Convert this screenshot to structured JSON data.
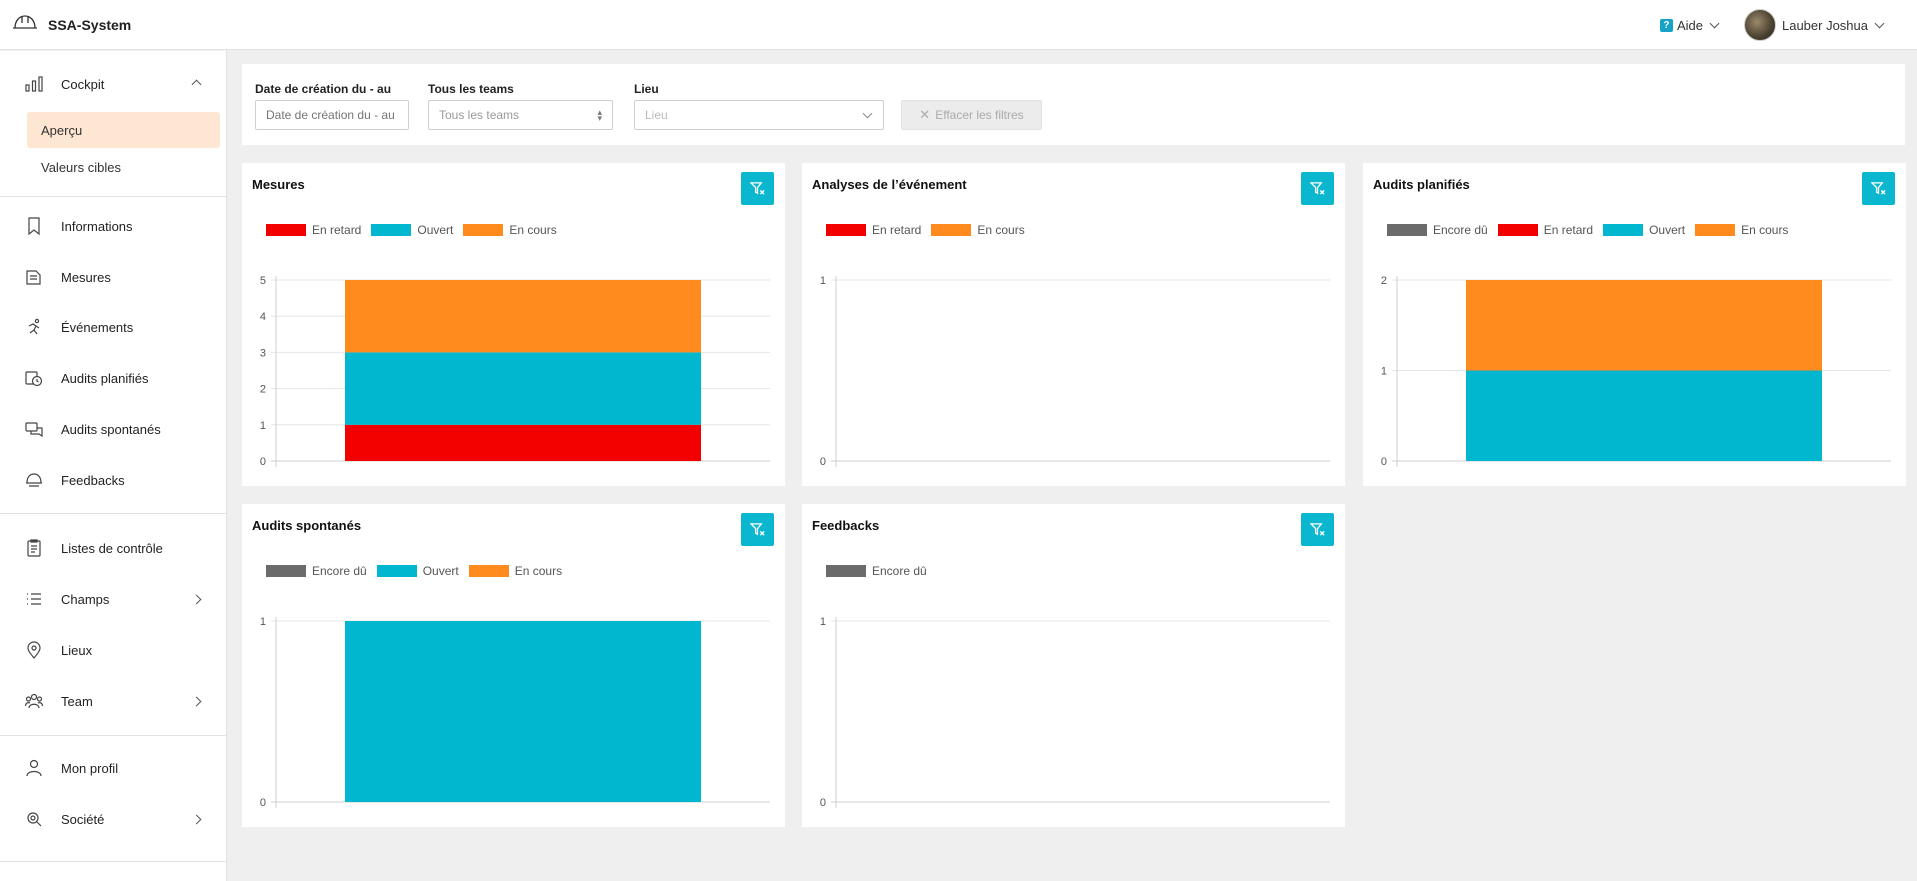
{
  "app": {
    "name": "SSA-System",
    "logo_icon": "hard-hat-icon"
  },
  "header": {
    "help_label": "Aide",
    "user_name": "Lauber Joshua"
  },
  "colors": {
    "accent": "#0bb7cf",
    "late": "#f20000",
    "open": "#00b7cf",
    "in_progress": "#ff8a1d",
    "due": "#6b6b6b",
    "active_bg": "#fde7d2"
  },
  "sidebar": {
    "cockpit": {
      "label": "Cockpit",
      "icon": "bar-chart-icon"
    },
    "cockpit_sub": [
      {
        "label": "Aperçu"
      },
      {
        "label": "Valeurs cibles"
      }
    ],
    "items": [
      {
        "label": "Informations",
        "icon": "bookmark-icon"
      },
      {
        "label": "Mesures",
        "icon": "document-icon"
      },
      {
        "label": "Événements",
        "icon": "running-person-icon"
      },
      {
        "label": "Audits planifiés",
        "icon": "calendar-clock-icon"
      },
      {
        "label": "Audits spontanés",
        "icon": "chat-icon"
      },
      {
        "label": "Feedbacks",
        "icon": "helmet-icon"
      }
    ],
    "items2": [
      {
        "label": "Listes de contrôle",
        "icon": "checklist-icon"
      },
      {
        "label": "Champs",
        "icon": "list-icon"
      },
      {
        "label": "Lieux",
        "icon": "location-pin-icon"
      },
      {
        "label": "Team",
        "icon": "team-icon"
      }
    ],
    "items3": [
      {
        "label": "Mon profil",
        "icon": "user-icon"
      },
      {
        "label": "Société",
        "icon": "company-settings-icon"
      }
    ]
  },
  "filters": {
    "date_label": "Date de création du - au",
    "date_placeholder": "Date de création du - au",
    "teams_label": "Tous les teams",
    "teams_value": "Tous les teams",
    "place_label": "Lieu",
    "place_placeholder": "Lieu",
    "clear_label": "Effacer les filtres"
  },
  "chart_data": [
    {
      "type": "bar",
      "title": "Mesures",
      "categories": [
        ""
      ],
      "series": [
        {
          "name": "En retard",
          "values": [
            1
          ]
        },
        {
          "name": "Ouvert",
          "values": [
            2
          ]
        },
        {
          "name": "En cours",
          "values": [
            2
          ]
        }
      ],
      "stacked": true,
      "ylim": [
        0,
        5
      ],
      "yticks": [
        0,
        1,
        2,
        3,
        4,
        5
      ],
      "grid": true,
      "legend": "top-left"
    },
    {
      "type": "bar",
      "title": "Analyses de l’événement",
      "categories": [
        ""
      ],
      "series": [
        {
          "name": "En retard",
          "values": [
            0
          ]
        },
        {
          "name": "En cours",
          "values": [
            0
          ]
        }
      ],
      "stacked": true,
      "ylim": [
        0,
        1
      ],
      "yticks": [
        0,
        1
      ],
      "grid": true,
      "legend": "top-left"
    },
    {
      "type": "bar",
      "title": "Audits planifiés",
      "categories": [
        ""
      ],
      "series": [
        {
          "name": "Encore dû",
          "values": [
            0
          ]
        },
        {
          "name": "En retard",
          "values": [
            0
          ]
        },
        {
          "name": "Ouvert",
          "values": [
            1
          ]
        },
        {
          "name": "En cours",
          "values": [
            1
          ]
        }
      ],
      "stacked": true,
      "ylim": [
        0,
        2
      ],
      "yticks": [
        0,
        1,
        2
      ],
      "grid": true,
      "legend": "top-left"
    },
    {
      "type": "bar",
      "title": "Audits spontanés",
      "categories": [
        ""
      ],
      "series": [
        {
          "name": "Encore dû",
          "values": [
            0
          ]
        },
        {
          "name": "Ouvert",
          "values": [
            1
          ]
        },
        {
          "name": "En cours",
          "values": [
            0
          ]
        }
      ],
      "stacked": true,
      "ylim": [
        0,
        1
      ],
      "yticks": [
        0,
        1
      ],
      "grid": true,
      "legend": "top-left"
    },
    {
      "type": "bar",
      "title": "Feedbacks",
      "categories": [
        ""
      ],
      "series": [
        {
          "name": "Encore dû",
          "values": [
            0
          ]
        }
      ],
      "stacked": true,
      "ylim": [
        0,
        1
      ],
      "yticks": [
        0,
        1
      ],
      "grid": true,
      "legend": "top-left"
    }
  ]
}
